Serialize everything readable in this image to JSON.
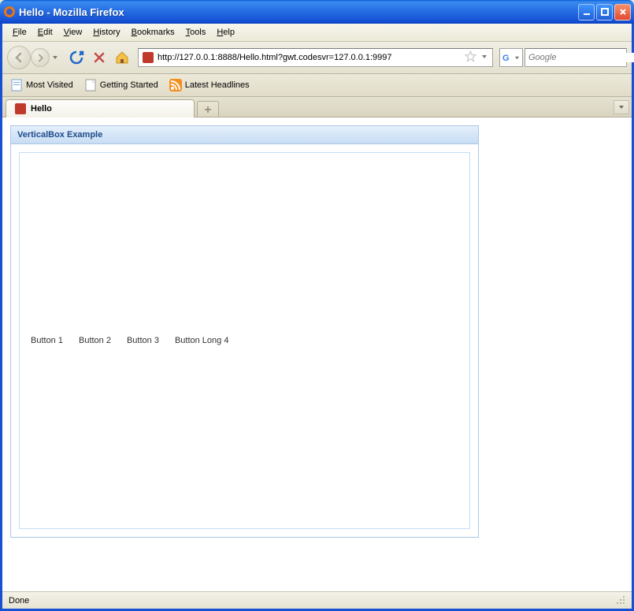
{
  "window": {
    "title": "Hello - Mozilla Firefox"
  },
  "menu": {
    "items": [
      "File",
      "Edit",
      "View",
      "History",
      "Bookmarks",
      "Tools",
      "Help"
    ]
  },
  "nav": {
    "url": "http://127.0.0.1:8888/Hello.html?gwt.codesvr=127.0.0.1:9997",
    "search_placeholder": "Google"
  },
  "bookmarks": {
    "items": [
      {
        "label": "Most Visited"
      },
      {
        "label": "Getting Started"
      },
      {
        "label": "Latest Headlines"
      }
    ]
  },
  "tabs": {
    "active": {
      "label": "Hello"
    }
  },
  "panel": {
    "title": "VerticalBox Example",
    "buttons": [
      "Button 1",
      "Button 2",
      "Button 3",
      "Button Long 4"
    ]
  },
  "status": {
    "text": "Done"
  }
}
